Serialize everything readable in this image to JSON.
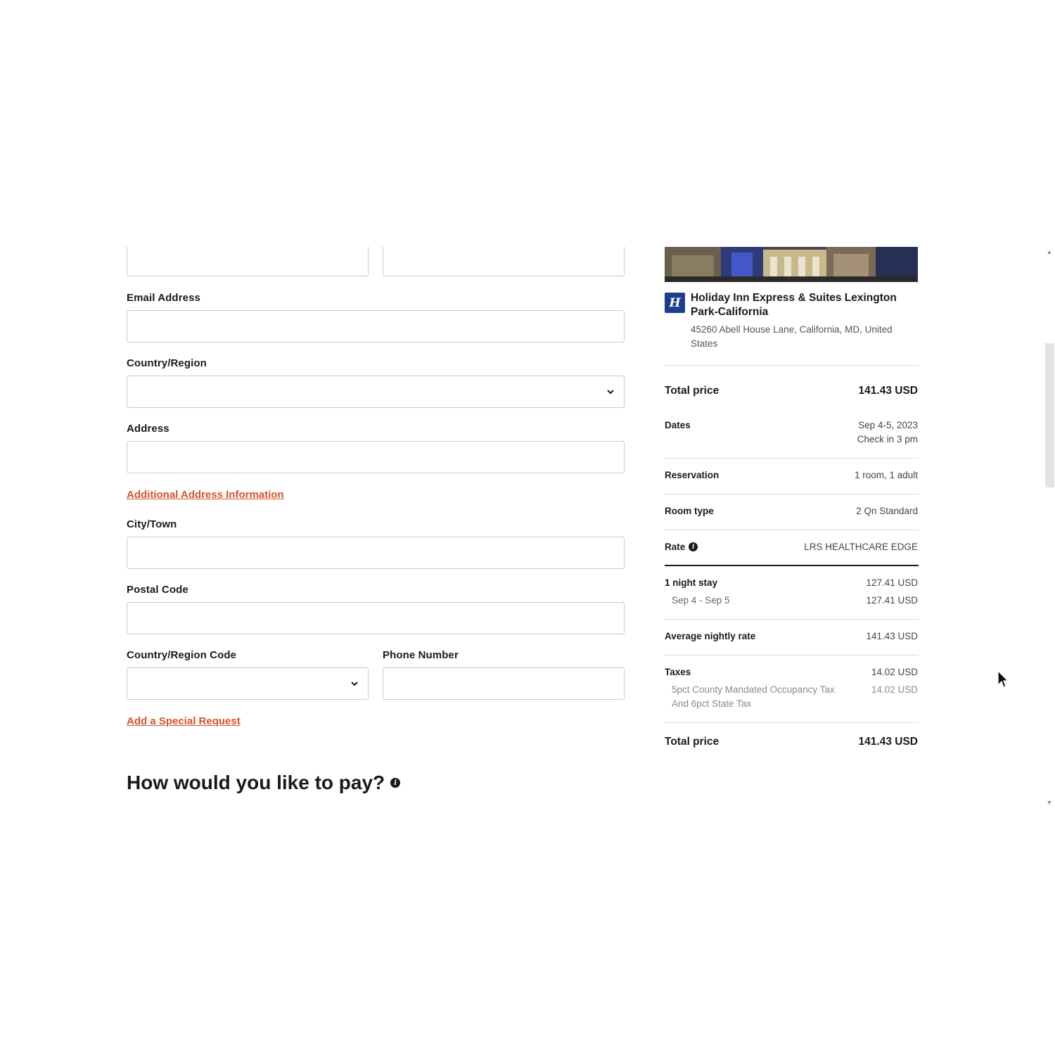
{
  "form": {
    "email_label": "Email Address",
    "country_label": "Country/Region",
    "address_label": "Address",
    "additional_address_link": "Additional Address Information",
    "city_label": "City/Town",
    "postal_label": "Postal Code",
    "country_code_label": "Country/Region Code",
    "phone_label": "Phone Number",
    "special_request_link": "Add a Special Request",
    "pay_heading": "How would you like to pay?"
  },
  "summary": {
    "hotel_name": "Holiday Inn Express & Suites Lexington Park-California",
    "hotel_address": "45260 Abell House Lane, California, MD, United States",
    "brand_glyph": "H",
    "total_price_label": "Total price",
    "total_price_value": "141.43 USD",
    "dates_label": "Dates",
    "dates_value": "Sep 4-5, 2023",
    "checkin_value": "Check in 3 pm",
    "reservation_label": "Reservation",
    "reservation_value": "1 room, 1 adult",
    "room_type_label": "Room type",
    "room_type_value": "2 Qn Standard",
    "rate_label": "Rate",
    "rate_value": "LRS HEALTHCARE EDGE",
    "stay_label": "1 night stay",
    "stay_value": "127.41 USD",
    "stay_dates": "Sep 4 - Sep 5",
    "stay_dates_value": "127.41 USD",
    "avg_rate_label": "Average nightly rate",
    "avg_rate_value": "141.43 USD",
    "taxes_label": "Taxes",
    "taxes_value": "14.02 USD",
    "tax_detail": "5pct County Mandated Occupancy Tax And 6pct State Tax",
    "tax_detail_value": "14.02 USD",
    "final_total_label": "Total price",
    "final_total_value": "141.43 USD"
  },
  "colors": {
    "link": "#d4532d",
    "brand": "#1d3f8f",
    "border": "#c9c9c9"
  }
}
